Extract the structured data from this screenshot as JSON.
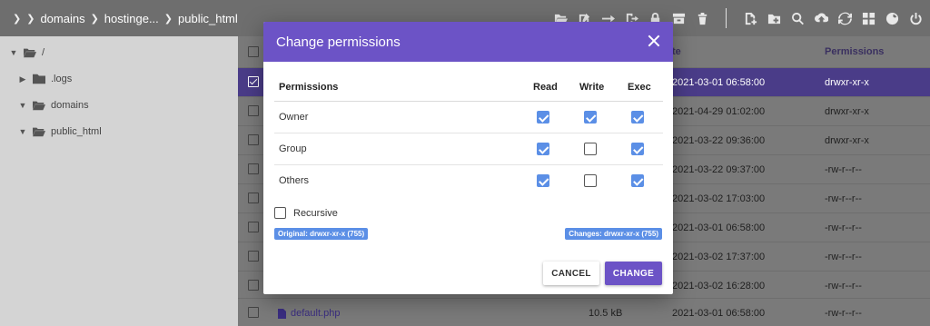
{
  "breadcrumb": {
    "items": [
      "domains",
      "hostinge...",
      "public_html"
    ]
  },
  "toolbar": {
    "icons": [
      "folder-open-icon",
      "edit-icon",
      "move-icon",
      "export-icon",
      "lock-icon",
      "archive-icon",
      "trash-icon",
      "add-file-icon",
      "add-folder-icon",
      "search-icon",
      "upload-icon",
      "refresh-icon",
      "grid-view-icon",
      "globe-icon",
      "power-icon"
    ]
  },
  "sidebar": {
    "items": [
      {
        "label": "/",
        "expanded": true
      },
      {
        "label": ".logs",
        "expanded": false
      },
      {
        "label": "domains",
        "expanded": true
      },
      {
        "label": "public_html",
        "expanded": true
      }
    ]
  },
  "table": {
    "columns": {
      "date": "te",
      "permissions": "Permissions"
    },
    "rows": [
      {
        "date": "2021-03-01 06:58:00",
        "permissions": "drwxr-xr-x",
        "selected": true
      },
      {
        "date": "2021-04-29 01:02:00",
        "permissions": "drwxr-xr-x",
        "selected": false
      },
      {
        "date": "2021-03-22 09:36:00",
        "permissions": "drwxr-xr-x",
        "selected": false
      },
      {
        "date": "2021-03-22 09:37:00",
        "permissions": "-rw-r--r--",
        "selected": false
      },
      {
        "date": "2021-03-02 17:03:00",
        "permissions": "-rw-r--r--",
        "selected": false
      },
      {
        "date": "2021-03-01 06:58:00",
        "permissions": "-rw-r--r--",
        "selected": false
      },
      {
        "date": "2021-03-02 17:37:00",
        "permissions": "-rw-r--r--",
        "selected": false
      },
      {
        "date": "2021-03-02 16:28:00",
        "permissions": "-rw-r--r--",
        "selected": false
      },
      {
        "name": "default.php",
        "size": "10.5 kB",
        "date": "2021-03-01 06:58:00",
        "permissions": "-rw-r--r--",
        "selected": false
      }
    ]
  },
  "dialog": {
    "title": "Change permissions",
    "header": {
      "permissions": "Permissions",
      "read": "Read",
      "write": "Write",
      "exec": "Exec"
    },
    "rows": [
      {
        "label": "Owner",
        "read": true,
        "write": true,
        "exec": true
      },
      {
        "label": "Group",
        "read": true,
        "write": false,
        "exec": true
      },
      {
        "label": "Others",
        "read": true,
        "write": false,
        "exec": true
      }
    ],
    "recursive_label": "Recursive",
    "recursive_checked": false,
    "original_badge": "Original: drwxr-xr-x (755)",
    "changes_badge": "Changes: drwxr-xr-x (755)",
    "cancel_label": "CANCEL",
    "change_label": "CHANGE"
  },
  "colors": {
    "accent": "#6c53c6",
    "checkbox_on": "#5b8fe6",
    "toolbar_bg": "#6e6e6e",
    "selected_row": "#4a3c88"
  }
}
